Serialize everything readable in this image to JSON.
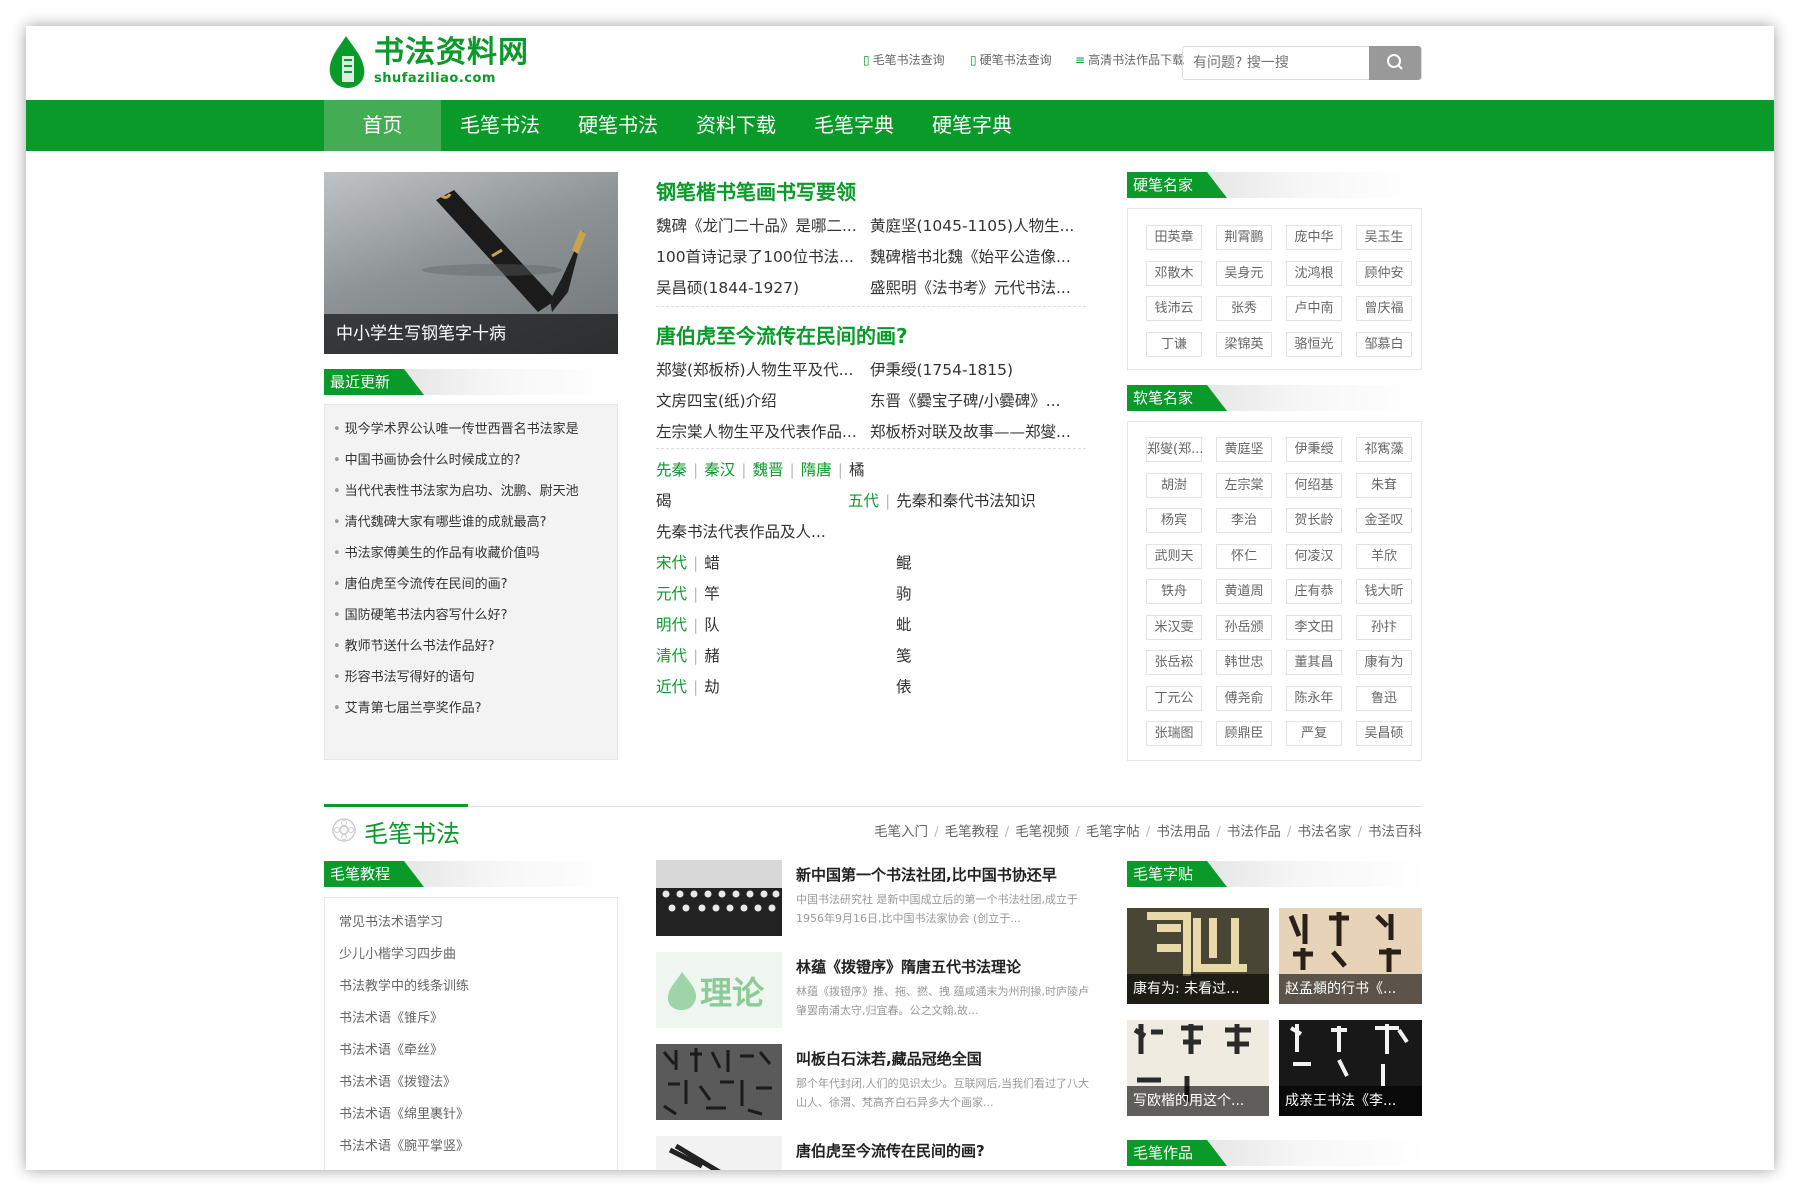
{
  "header": {
    "logo_cn": "书法资料网",
    "logo_en": "shufaziliao.com",
    "links": [
      "毛笔书法查询",
      "硬笔书法查询",
      "高清书法作品下载"
    ],
    "search_placeholder": "有问题? 搜一搜"
  },
  "nav": [
    "首页",
    "毛笔书法",
    "硬笔书法",
    "资料下载",
    "毛笔字典",
    "硬笔字典"
  ],
  "hero": {
    "caption": "中小学生写钢笔字十病"
  },
  "recent": {
    "title": "最近更新",
    "items": [
      "现今学术界公认唯一传世西晋名书法家是",
      "中国书画协会什么时候成立的?",
      "当代代表性书法家为启功、沈鹏、尉天池",
      "清代魏碑大家有哪些谁的成就最高?",
      "书法家傅美生的作品有收藏价值吗",
      "唐伯虎至今流传在民间的画?",
      "国防硬笔书法内容写什么好?",
      "教师节送什么书法作品好?",
      "形容书法写得好的语句",
      "艾青第七届兰亭奖作品?"
    ]
  },
  "middle": {
    "article1": {
      "title": "钢笔楷书笔画书写要领",
      "links": [
        "魏碑《龙门二十品》是哪二...",
        "黄庭坚(1045-1105)人物生...",
        "100首诗记录了100位书法...",
        "魏碑楷书北魏《始平公造像...",
        "吴昌硕(1844-1927)",
        "盛熙明《法书考》元代书法..."
      ]
    },
    "article2": {
      "title": "唐伯虎至今流传在民间的画?",
      "links": [
        "郑燮(郑板桥)人物生平及代...",
        "伊秉绶(1754-1815)",
        "文房四宝(纸)介绍",
        "东晋《爨宝子碑/小爨碑》...",
        "左宗棠人物生平及代表作品...",
        "郑板桥对联及故事——郑燮..."
      ]
    },
    "dyn": {
      "row1": [
        "先秦",
        "秦汉",
        "魏晋",
        "隋唐"
      ],
      "row1_last": "橘",
      "row2_left": "碣",
      "row2_green": "五代",
      "row2_text": "先秦和秦代书法知识",
      "row3": "先秦书法代表作品及人...",
      "rows": [
        {
          "d": "宋代",
          "a": "蜡",
          "b": "鲲"
        },
        {
          "d": "元代",
          "a": "竿",
          "b": "驹"
        },
        {
          "d": "明代",
          "a": "队",
          "b": "蚍"
        },
        {
          "d": "清代",
          "a": "赭",
          "b": "笺"
        },
        {
          "d": "近代",
          "a": "劫",
          "b": "俵"
        }
      ]
    }
  },
  "right": {
    "hard_title": "硬笔名家",
    "hard": [
      "田英章",
      "荆霄鹏",
      "庞中华",
      "吴玉生",
      "邓散木",
      "吴身元",
      "沈鸿根",
      "顾仲安",
      "钱沛云",
      "张秀",
      "卢中南",
      "曾庆福",
      "丁谦",
      "梁锦英",
      "骆恒光",
      "邹慕白"
    ],
    "soft_title": "软笔名家",
    "soft": [
      "郑燮(郑...",
      "黄庭坚",
      "伊秉绶",
      "祁寯藻",
      "胡澍",
      "左宗棠",
      "何绍基",
      "朱耷",
      "杨宾",
      "李治",
      "贺长龄",
      "金圣叹",
      "武则天",
      "怀仁",
      "何凌汉",
      "羊欣",
      "铁舟",
      "黄道周",
      "庄有恭",
      "钱大昕",
      "米汉雯",
      "孙岳颁",
      "李文田",
      "孙抃",
      "张岳崧",
      "韩世忠",
      "董其昌",
      "康有为",
      "丁元公",
      "傅尧俞",
      "陈永年",
      "鲁迅",
      "张瑞图",
      "顾鼎臣",
      "严复",
      "吴昌硕"
    ]
  },
  "maobi": {
    "title": "毛笔书法",
    "tabs": [
      "毛笔入门",
      "毛笔教程",
      "毛笔视频",
      "毛笔字帖",
      "书法用品",
      "书法作品",
      "书法名家",
      "书法百科"
    ],
    "tutorial_title": "毛笔教程",
    "tutorials": [
      "常见书法术语学习",
      "少儿小楷学习四步曲",
      "书法教学中的线条训练",
      "书法术语《锥斥》",
      "书法术语《牵丝》",
      "书法术语《拨镫法》",
      "书法术语《绵里裹针》",
      "书法术语《腕平掌竖》"
    ],
    "news": [
      {
        "title": "新中国第一个书法社团,比中国书协还早",
        "desc": "中国书法研究社 是新中国成立后的第一个书法社团,成立于1956年9月16日,比中国书法家协会 (创立于..."
      },
      {
        "title": "林蕴《拨镫序》隋唐五代书法理论",
        "desc": "林蕴《拨镫序》推、拖、撚、拽 蕴咸通末为州刑掾,时庐陵卢肇罢南浦太守,归宜春。公之文翰,故..."
      },
      {
        "title": "叫板白石沫若,藏品冠绝全国",
        "desc": "那个年代封闭,人们的见识太少。互联网后,当我们看过了八大山人、徐渭、梵高齐白石异多大个画家..."
      },
      {
        "title": "唐伯虎至今流传在民间的画?",
        "desc": ""
      }
    ],
    "thumb_label": "理论",
    "zitie_title": "毛笔字贴",
    "zitie": [
      "康有为: 未看过...",
      "赵孟頫的行书《...",
      "写欧楷的用这个...",
      "成亲王书法《李..."
    ],
    "works_title": "毛笔作品"
  },
  "colors": {
    "green": "#0a9a2a",
    "nav_active": "#44ac52"
  }
}
